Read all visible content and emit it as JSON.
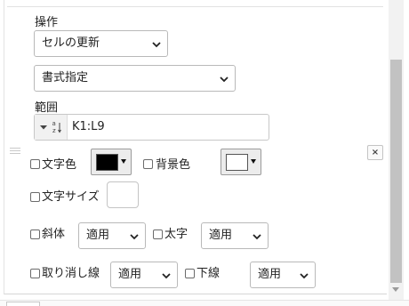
{
  "operation": {
    "label": "操作",
    "action_select": "セルの更新",
    "mode_select": "書式指定"
  },
  "range": {
    "label": "範囲",
    "value": "K1:L9",
    "sort_icon": "a-z-sort-icon"
  },
  "format": {
    "font_color_label": "文字色",
    "font_color": "#000000",
    "bg_color_label": "背景色",
    "bg_color": "#ffffff",
    "font_size_label": "文字サイズ",
    "font_size_value": "",
    "italic_label": "斜体",
    "italic_value": "適用",
    "bold_label": "太字",
    "bold_value": "適用",
    "strike_label": "取り消し線",
    "strike_value": "適用",
    "underline_label": "下線",
    "underline_value": "適用"
  },
  "controls": {
    "remove_label": "×"
  }
}
